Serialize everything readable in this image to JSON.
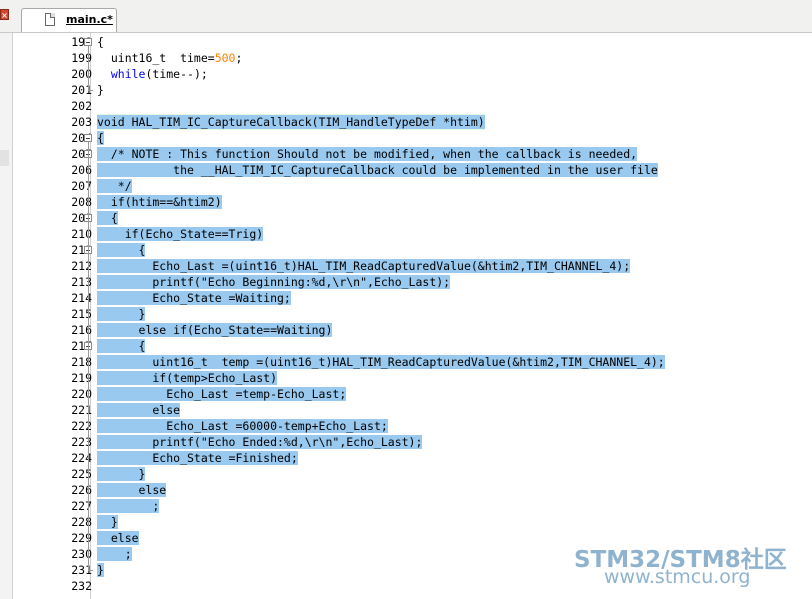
{
  "tab": {
    "label": "main.c*"
  },
  "lines": [
    {
      "n": "198",
      "text": "{",
      "fold": "open",
      "sel": false
    },
    {
      "n": "199",
      "pre": "  uint16_t  time=",
      "num": "500",
      "post": ";",
      "sel": false
    },
    {
      "n": "200",
      "pre": "  ",
      "kw": "while",
      "post": "(time--);",
      "sel": false
    },
    {
      "n": "201",
      "text": "}",
      "sel": false
    },
    {
      "n": "202",
      "text": "",
      "sel": false
    },
    {
      "n": "203",
      "text": "void HAL_TIM_IC_CaptureCallback(TIM_HandleTypeDef *htim)",
      "sel": true,
      "current": true
    },
    {
      "n": "204",
      "text": "{",
      "fold": "open",
      "sel": true
    },
    {
      "n": "205",
      "text": "  /* NOTE : This function Should not be modified, when the callback is needed,",
      "fold": "open",
      "sel": true
    },
    {
      "n": "206",
      "text": "           the __HAL_TIM_IC_CaptureCallback could be implemented in the user file",
      "sel": true
    },
    {
      "n": "207",
      "text": "   */",
      "sel": true
    },
    {
      "n": "208",
      "text": "  if(htim==&htim2)",
      "sel": true
    },
    {
      "n": "209",
      "text": "  {",
      "fold": "open",
      "sel": true
    },
    {
      "n": "210",
      "text": "    if(Echo_State==Trig)",
      "sel": true
    },
    {
      "n": "211",
      "text": "      {",
      "fold": "open",
      "sel": true
    },
    {
      "n": "212",
      "text": "        Echo_Last =(uint16_t)HAL_TIM_ReadCapturedValue(&htim2,TIM_CHANNEL_4);",
      "sel": true
    },
    {
      "n": "213",
      "text": "        printf(\"Echo Beginning:%d,\\r\\n\",Echo_Last);",
      "sel": true
    },
    {
      "n": "214",
      "text": "        Echo_State =Waiting;",
      "sel": true
    },
    {
      "n": "215",
      "text": "      }",
      "sel": true
    },
    {
      "n": "216",
      "text": "      else if(Echo_State==Waiting)",
      "sel": true
    },
    {
      "n": "217",
      "text": "      {",
      "fold": "open",
      "sel": true
    },
    {
      "n": "218",
      "text": "        uint16_t  temp =(uint16_t)HAL_TIM_ReadCapturedValue(&htim2,TIM_CHANNEL_4);",
      "sel": true
    },
    {
      "n": "219",
      "text": "        if(temp>Echo_Last)",
      "sel": true
    },
    {
      "n": "220",
      "text": "          Echo_Last =temp-Echo_Last;",
      "sel": true
    },
    {
      "n": "221",
      "text": "        else",
      "sel": true
    },
    {
      "n": "222",
      "text": "          Echo_Last =60000-temp+Echo_Last;",
      "sel": true
    },
    {
      "n": "223",
      "text": "        printf(\"Echo Ended:%d,\\r\\n\",Echo_Last);",
      "sel": true
    },
    {
      "n": "224",
      "text": "        Echo_State =Finished;",
      "sel": true
    },
    {
      "n": "225",
      "text": "      }",
      "sel": true
    },
    {
      "n": "226",
      "text": "      else",
      "sel": true
    },
    {
      "n": "227",
      "text": "        ;",
      "sel": true
    },
    {
      "n": "228",
      "text": "  }",
      "sel": true
    },
    {
      "n": "229",
      "text": "  else",
      "sel": true
    },
    {
      "n": "230",
      "text": "    ;",
      "sel": true
    },
    {
      "n": "231",
      "text": "}",
      "sel": true
    },
    {
      "n": "232",
      "text": "",
      "sel": false
    }
  ],
  "watermark": {
    "brand": "STM32/STM8社区",
    "url": "www.stmcu.org"
  },
  "colors": {
    "selection": "#99c9ef",
    "current_line": "#e3f7e3",
    "keyword": "#0000ff",
    "number": "#ff8000"
  }
}
